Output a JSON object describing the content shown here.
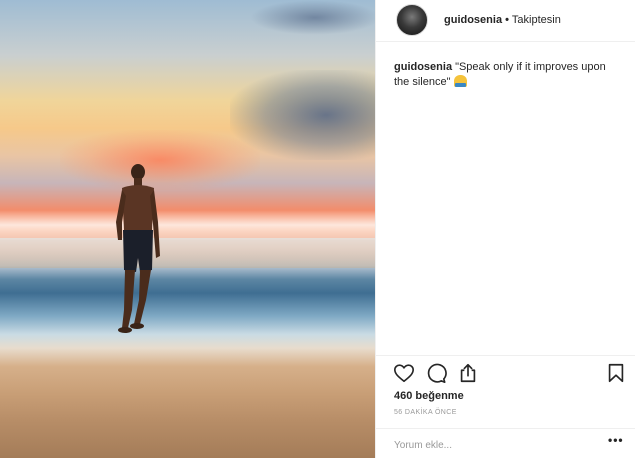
{
  "post": {
    "username": "guidosenia",
    "separator": "•",
    "follow_status": "Takiptesin",
    "caption_text": "\"Speak only if it improves upon the silence\"",
    "caption_emoji": "person-meditating-emoji",
    "likes": "460 beğenme",
    "time_ago": "56 DAKİKA ÖNCE"
  },
  "actions": {
    "like_icon": "heart-icon",
    "comment_icon": "comment-icon",
    "share_icon": "share-icon",
    "save_icon": "bookmark-icon"
  },
  "comment_box": {
    "placeholder": "Yorum ekle...",
    "more_label": "•••"
  },
  "colors": {
    "text": "#262626",
    "muted": "#999999",
    "border": "#efefef"
  }
}
